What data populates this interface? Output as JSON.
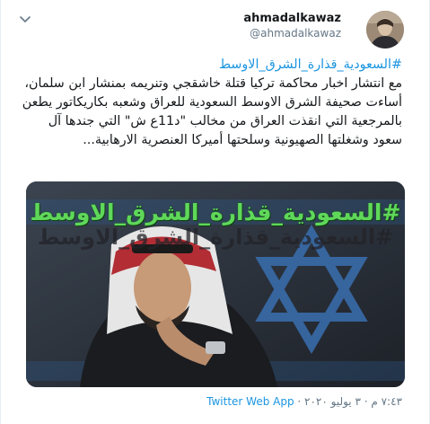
{
  "tweet": {
    "author_name": "ahmadalkawaz",
    "author_handle": "@ahmadalkawaz",
    "hashtag": "#السعودية_قذارة_الشرق_الاوسط",
    "body": "مع انتشار اخبار محاكمة تركيا قتلة خاشقجي وتنريمه بمنشار ابن سلمان، أساءت صحيفة الشرق الاوسط السعودية للعراق وشعبه بكاريكاتور يطعن بالمرجعية التي انقذت العراق من مخالب \"د11ع ش\" التي جندها آل سعود وشغلتها الصهيونية وسلحتها أميركا العنصرية الارهابية...",
    "media_overlay_text": "#السعودية_قذارة_الشرق_الاوسط",
    "timestamp": "٧:٤٣ م · ٣ يوليو ٢٠٢٠",
    "separator": " · ",
    "source": "Twitter Web App"
  },
  "icons": {
    "menu": "chevron-down-icon",
    "avatar": "avatar"
  },
  "colors": {
    "link": "#1b95e0",
    "text": "#14171a",
    "muted": "#657786",
    "overlay_green": "#5fd85a"
  }
}
